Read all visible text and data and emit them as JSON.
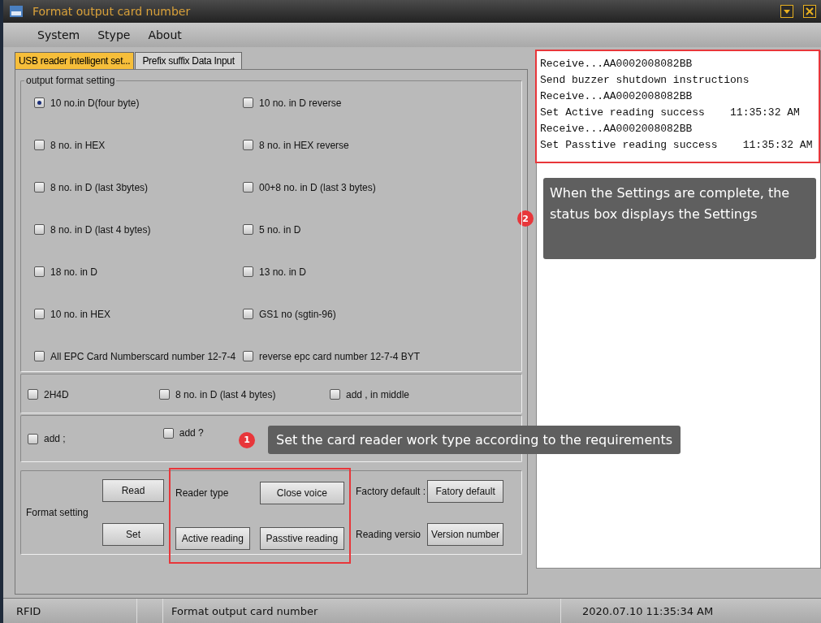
{
  "window": {
    "title": "Format output  card number"
  },
  "menu": [
    {
      "label": "System"
    },
    {
      "label": "Stype"
    },
    {
      "label": "About"
    }
  ],
  "tabs": [
    {
      "label": "USB reader intelligent set...",
      "selected": true
    },
    {
      "label": "Prefix suffix Data Input",
      "selected": false
    }
  ],
  "output_format": {
    "title": "output format setting",
    "options": [
      {
        "label": "10 no.in D(four byte)",
        "checked": true
      },
      {
        "label": "10 no. in D reverse",
        "checked": false
      },
      {
        "label": "8 no. in HEX",
        "checked": false
      },
      {
        "label": "8 no. in HEX reverse",
        "checked": false
      },
      {
        "label": "8 no. in D (last 3bytes)",
        "checked": false
      },
      {
        "label": "00+8 no. in D (last 3 bytes)",
        "checked": false
      },
      {
        "label": "8 no. in D (last 4 bytes)",
        "checked": false
      },
      {
        "label": "5 no. in D",
        "checked": false
      },
      {
        "label": "18 no. in D",
        "checked": false
      },
      {
        "label": "13 no. in D",
        "checked": false
      },
      {
        "label": "10 no. in HEX",
        "checked": false
      },
      {
        "label": "GS1 no (sgtin-96)",
        "checked": false
      },
      {
        "label": "All EPC Card Numberscard number 12-7-4",
        "checked": false
      },
      {
        "label": "reverse epc card number 12-7-4 BYT",
        "checked": false
      }
    ]
  },
  "extra_options": [
    {
      "label": "2H4D",
      "checked": false
    },
    {
      "label": "8 no. in D (last 4 bytes)",
      "checked": false
    },
    {
      "label": "add , in middle",
      "checked": false
    }
  ],
  "separator_options": [
    {
      "label": "add ;",
      "checked": false
    },
    {
      "label": "add ?",
      "checked": false
    }
  ],
  "controls": {
    "format_label": "Format setting",
    "read": "Read",
    "set": "Set",
    "reader_type_label": "Reader type",
    "close_voice": "Close voice",
    "active_reading": "Active reading",
    "passive_reading": "Passtive reading",
    "factory_label": "Factory default :",
    "factory_button": "Fatory default",
    "version_label": "Reading versio",
    "version_button": "Version number"
  },
  "log": [
    "Receive...AA0002008082BB",
    "Send buzzer shutdown instructions",
    "Receive...AA0002008082BB",
    "Set Active reading success    11:35:32 AM",
    "Receive...AA0002008082BB",
    "Set Passtive reading success    11:35:32 AM"
  ],
  "callouts": [
    {
      "number": "1",
      "text": "Set the card reader work type according to the requirements"
    },
    {
      "number": "2",
      "text": "When the Settings are complete, the status box displays the Settings"
    }
  ],
  "status_bar": {
    "app": "RFID",
    "title": "Format output  card number",
    "datetime": "2020.07.10   11:35:34 AM"
  }
}
